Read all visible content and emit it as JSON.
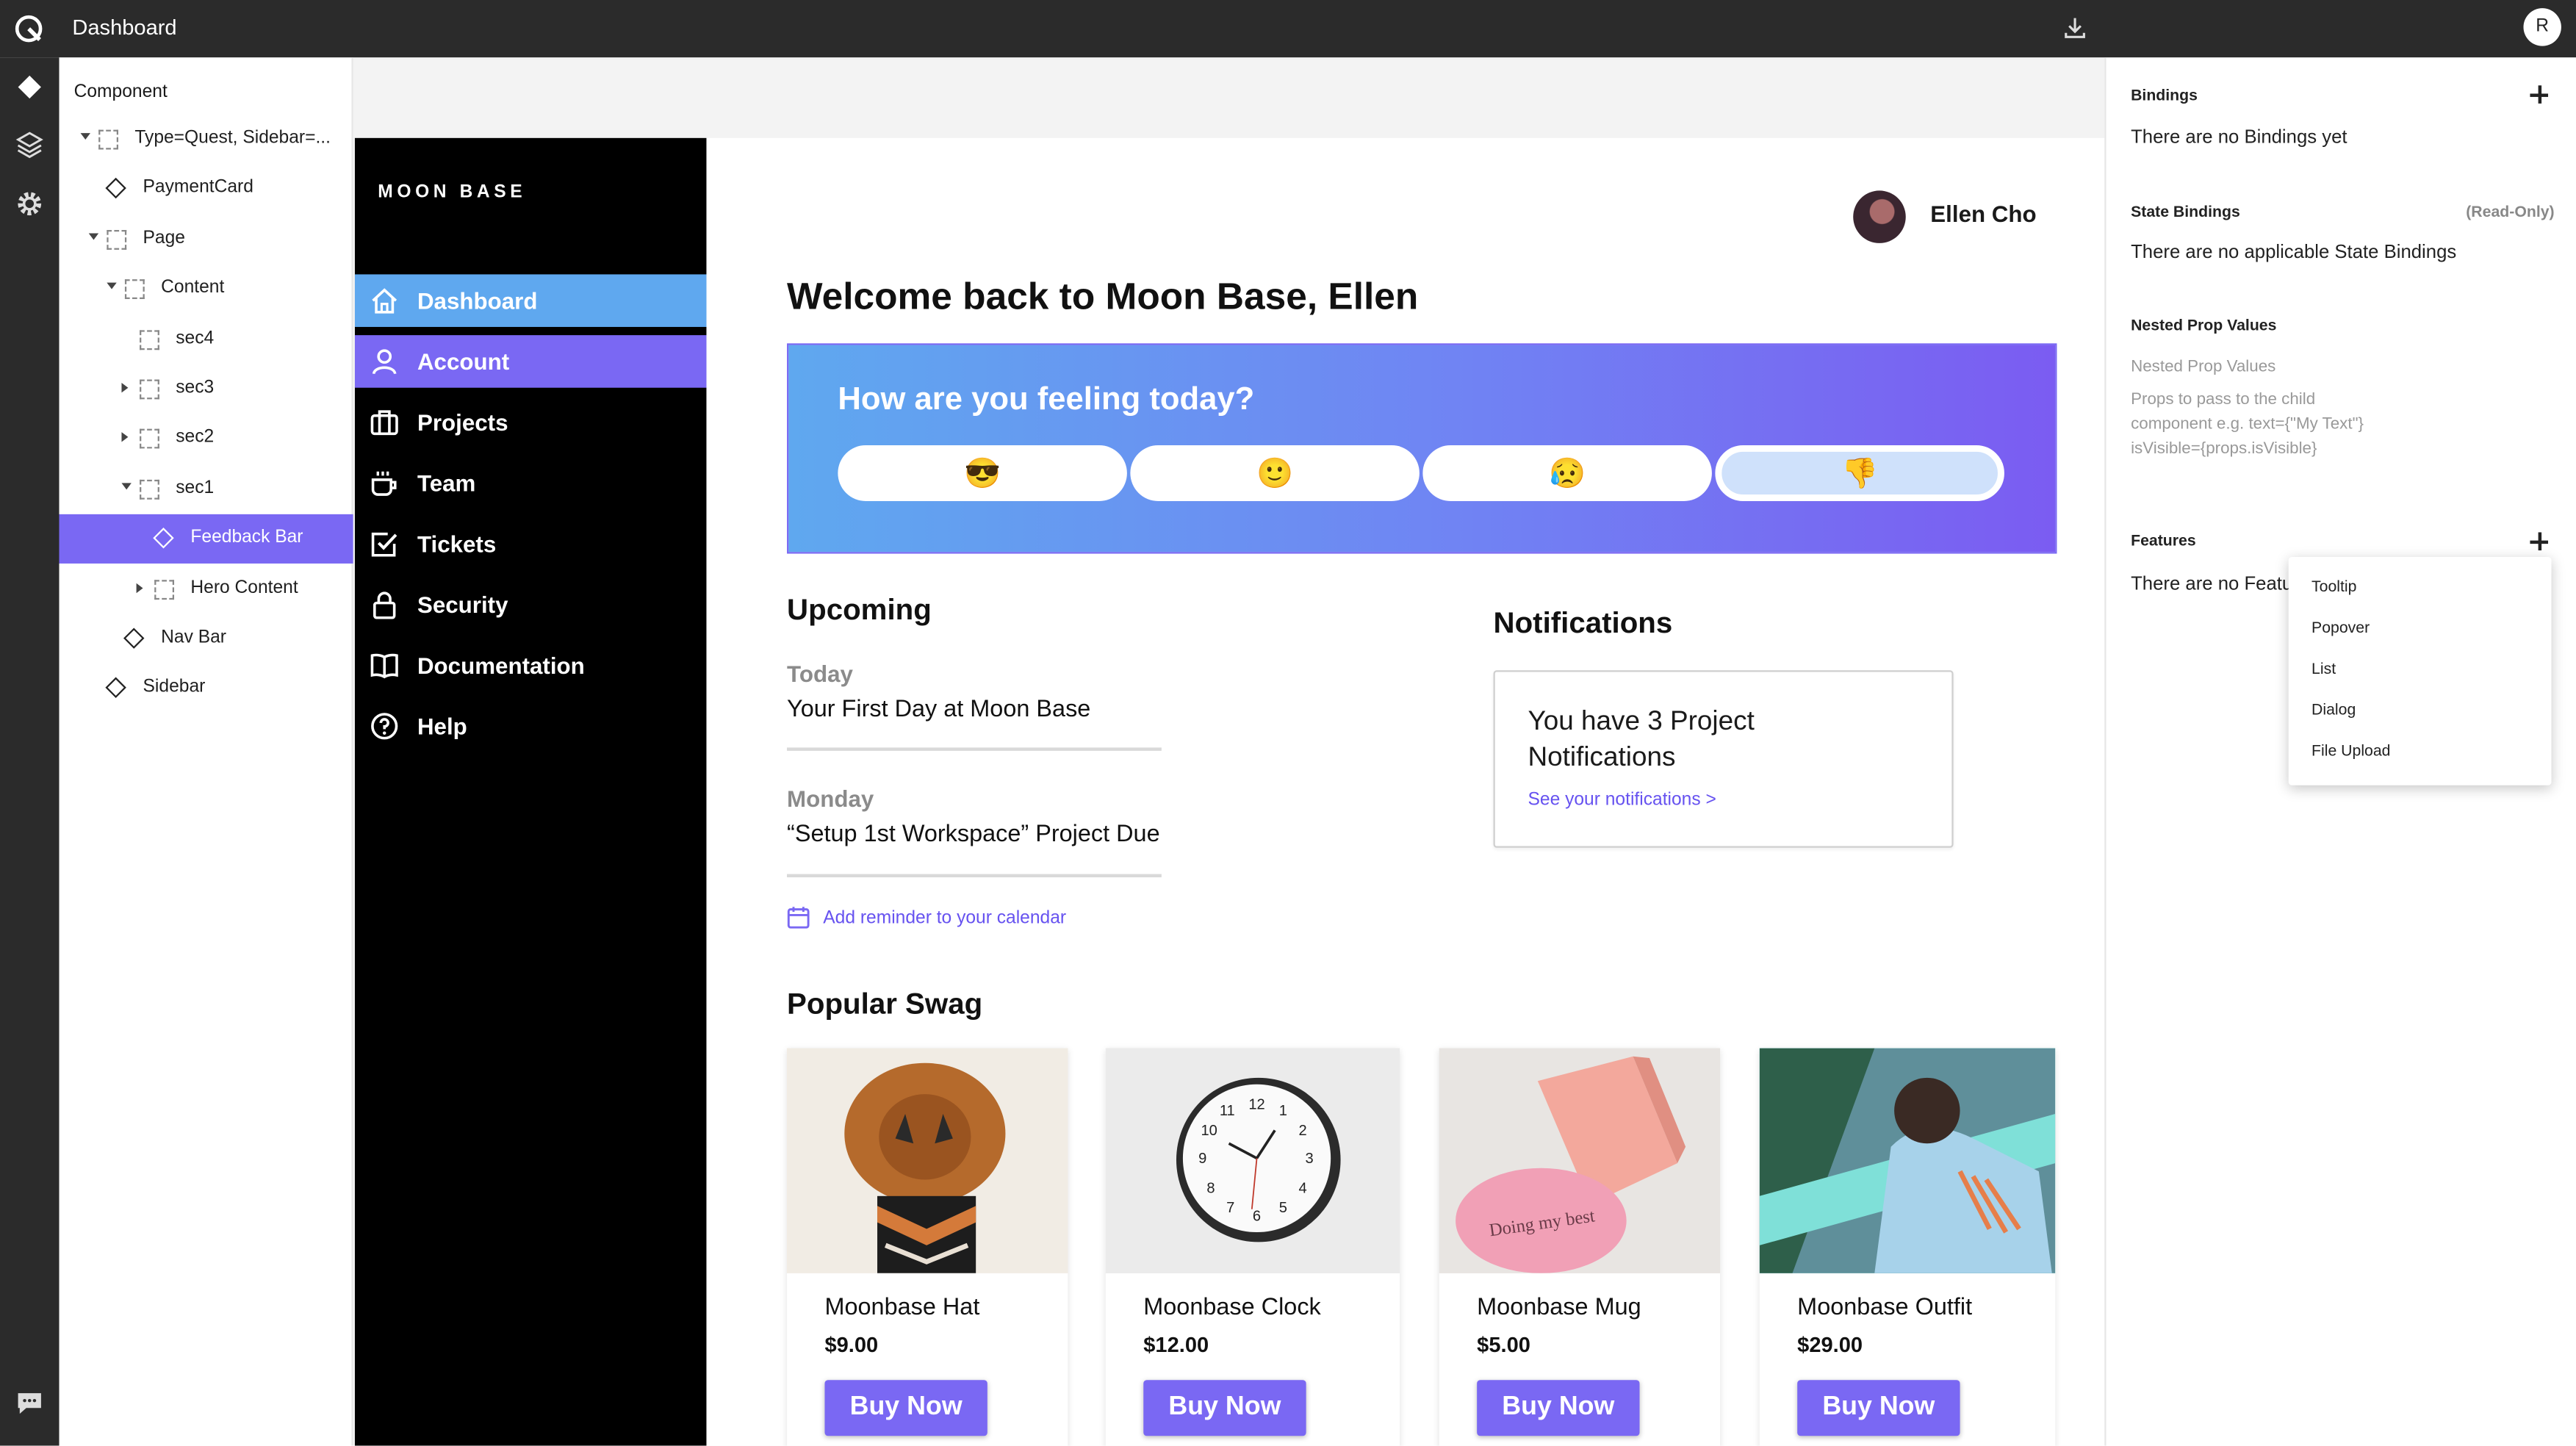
{
  "topbar": {
    "title": "Dashboard",
    "avatar_initial": "R"
  },
  "rail": {
    "icons": [
      "component-icon",
      "layers-icon",
      "settings-icon",
      "chat-icon"
    ]
  },
  "tree": {
    "header": "Component",
    "nodes": [
      {
        "label": "Type=Quest, Sidebar=...",
        "kind": "frame",
        "caret": "down",
        "depth": 0
      },
      {
        "label": "PaymentCard",
        "kind": "component",
        "caret": "",
        "depth": 1
      },
      {
        "label": "Page",
        "kind": "frame",
        "caret": "down",
        "depth": 1
      },
      {
        "label": "Content",
        "kind": "frame",
        "caret": "down",
        "depth": 2
      },
      {
        "label": "sec4",
        "kind": "frame",
        "caret": "",
        "depth": 3
      },
      {
        "label": "sec3",
        "kind": "frame",
        "caret": "right",
        "depth": 3
      },
      {
        "label": "sec2",
        "kind": "frame",
        "caret": "right",
        "depth": 3
      },
      {
        "label": "sec1",
        "kind": "frame",
        "caret": "down",
        "depth": 3
      },
      {
        "label": "Feedback Bar",
        "kind": "component",
        "caret": "",
        "depth": 4,
        "selected": true
      },
      {
        "label": "Hero Content",
        "kind": "frame",
        "caret": "right",
        "depth": 4
      },
      {
        "label": "Nav Bar",
        "kind": "component",
        "caret": "",
        "depth": 2
      },
      {
        "label": "Sidebar",
        "kind": "component",
        "caret": "",
        "depth": 1
      }
    ]
  },
  "app": {
    "brand": "MOON BASE",
    "nav": [
      {
        "label": "Dashboard",
        "icon": "home-icon",
        "state": "active"
      },
      {
        "label": "Account",
        "icon": "user-icon",
        "state": "hover"
      },
      {
        "label": "Projects",
        "icon": "briefcase-icon",
        "state": ""
      },
      {
        "label": "Team",
        "icon": "coffee-icon",
        "state": ""
      },
      {
        "label": "Tickets",
        "icon": "checkbox-icon",
        "state": ""
      },
      {
        "label": "Security",
        "icon": "lock-icon",
        "state": ""
      },
      {
        "label": "Documentation",
        "icon": "book-icon",
        "state": ""
      },
      {
        "label": "Help",
        "icon": "help-icon",
        "state": ""
      }
    ],
    "user_name": "Ellen Cho",
    "welcome": "Welcome back to Moon Base, Ellen",
    "feeling": {
      "question": "How are you feeling today?",
      "options": [
        "😎",
        "🙂",
        "😥",
        "👎"
      ],
      "selected_index": 3
    },
    "upcoming": {
      "title": "Upcoming",
      "events": [
        {
          "day": "Today",
          "text": "Your First Day at Moon Base"
        },
        {
          "day": "Monday",
          "text": "“Setup 1st Workspace” Project Due"
        }
      ],
      "reminder": "Add reminder to your calendar"
    },
    "notifications": {
      "title": "Notifications",
      "line1": "You have 3 Project",
      "line2": "Notifications",
      "link": "See your notifications >"
    },
    "swag": {
      "title": "Popular Swag",
      "items": [
        {
          "name": "Moonbase Hat",
          "price": "$9.00",
          "cta": "Buy Now"
        },
        {
          "name": "Moonbase Clock",
          "price": "$12.00",
          "cta": "Buy Now"
        },
        {
          "name": "Moonbase Mug",
          "price": "$5.00",
          "cta": "Buy Now",
          "mug_text": "Doing my best"
        },
        {
          "name": "Moonbase Outfit",
          "price": "$29.00",
          "cta": "Buy Now"
        }
      ]
    }
  },
  "panel": {
    "bindings": {
      "title": "Bindings",
      "empty": "There are no Bindings yet"
    },
    "state_bindings": {
      "title": "State Bindings",
      "note": "(Read-Only)",
      "empty": "There are no applicable State Bindings"
    },
    "nested": {
      "title": "Nested Prop Values",
      "subtitle": "Nested Prop Values",
      "line1": "Props to pass to the child",
      "line2": "component e.g. text={\"My Text\"}",
      "line3": "isVisible={props.isVisible}"
    },
    "features": {
      "title": "Features",
      "empty": "There are no Featu"
    },
    "menu": [
      "Tooltip",
      "Popover",
      "List",
      "Dialog",
      "File Upload"
    ]
  },
  "colors": {
    "accent": "#7a68f3",
    "active_nav": "#5fa8ef",
    "chrome": "#2b2b2b"
  }
}
